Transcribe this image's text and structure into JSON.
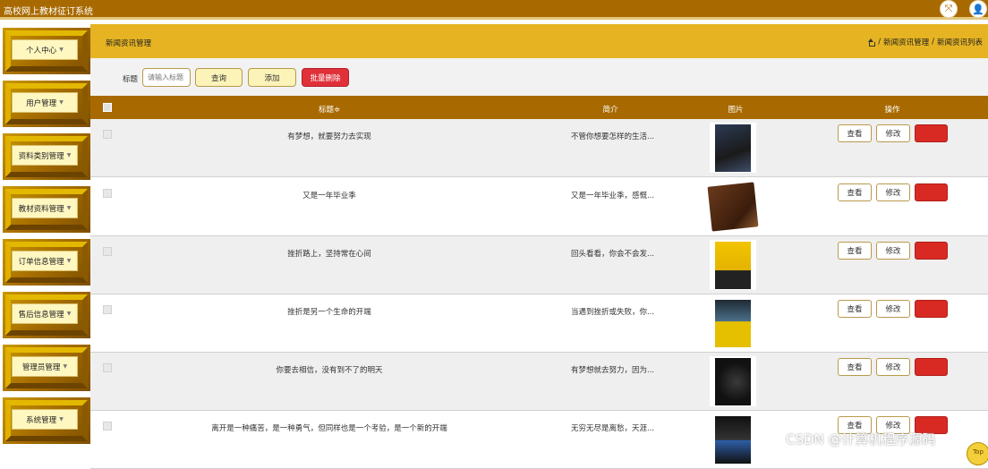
{
  "app": {
    "title": "高校网上教材征订系统"
  },
  "topbar": {
    "expand_icon": "fullscreen-icon",
    "user_icon": "user-icon"
  },
  "sidebar": {
    "items": [
      {
        "label": "个人中心"
      },
      {
        "label": "用户管理"
      },
      {
        "label": "资料类别管理"
      },
      {
        "label": "教材资料管理"
      },
      {
        "label": "订单信息管理"
      },
      {
        "label": "售后信息管理"
      },
      {
        "label": "管理员管理"
      },
      {
        "label": "系统管理"
      }
    ]
  },
  "page": {
    "title": "新闻资讯管理",
    "breadcrumb": [
      "新闻资讯管理",
      "新闻资讯列表"
    ],
    "breadcrumb_sep": "/"
  },
  "search": {
    "label": "标题",
    "placeholder": "请输入标题",
    "query_label": "查询",
    "add_label": "添加",
    "batch_delete_label": "批量删除"
  },
  "table": {
    "headers": {
      "title": "标题≑",
      "intro": "简介",
      "image": "图片",
      "actions": "操作"
    },
    "rows": [
      {
        "title": "有梦想，就要努力去实现",
        "intro": "不管你想要怎样的生活...",
        "view": "查看",
        "edit": "修改",
        "delete": "删除"
      },
      {
        "title": "又是一年毕业季",
        "intro": "又是一年毕业季，感慨...",
        "view": "查看",
        "edit": "修改",
        "delete": "删除"
      },
      {
        "title": "挫折路上，坚持常在心间",
        "intro": "回头看看，你会不会发...",
        "view": "查看",
        "edit": "修改",
        "delete": "删除"
      },
      {
        "title": "挫折是另一个生命的开端",
        "intro": "当遇到挫折或失败，你...",
        "view": "查看",
        "edit": "修改",
        "delete": "删除"
      },
      {
        "title": "你要去相信，没有到不了的明天",
        "intro": "有梦想就去努力，因为...",
        "view": "查看",
        "edit": "修改",
        "delete": "删除"
      },
      {
        "title": "离开是一种痛苦，是一种勇气，但同样也是一个考验，是一个新的开端",
        "intro": "无穷无尽是离愁，天涯...",
        "view": "查看",
        "edit": "修改",
        "delete": "删除"
      }
    ]
  },
  "watermark": "CSDN @计算机程序源码",
  "back_to_top": "Top",
  "colors": {
    "primary": "#a86a00",
    "header": "#e6b422",
    "danger": "#e0303a",
    "button": "#fbf3b8"
  }
}
